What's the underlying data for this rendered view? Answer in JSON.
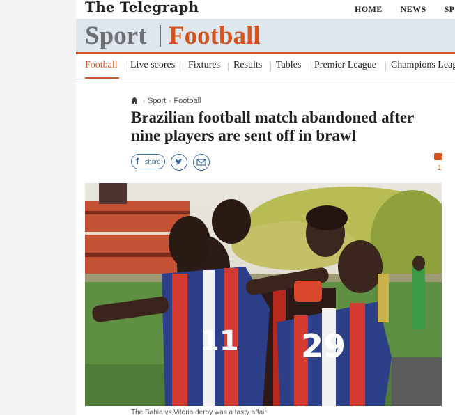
{
  "header": {
    "logo": "The Telegraph",
    "top_nav": [
      "HOME",
      "NEWS",
      "SPO"
    ]
  },
  "section": {
    "sport": "Sport",
    "football": "Football"
  },
  "subnav": [
    {
      "label": "Football",
      "active": true
    },
    {
      "label": "Live scores",
      "active": false
    },
    {
      "label": "Fixtures",
      "active": false
    },
    {
      "label": "Results",
      "active": false
    },
    {
      "label": "Tables",
      "active": false
    },
    {
      "label": "Premier League",
      "active": false
    },
    {
      "label": "Champions Leag",
      "active": false
    }
  ],
  "breadcrumb": {
    "home_icon": "home-icon",
    "items": [
      "Sport",
      "Football"
    ]
  },
  "article": {
    "headline": "Brazilian football match abandoned after nine players are sent off in brawl",
    "share_label": "share",
    "comment_count": "1",
    "caption": "The Bahia vs Vitoria derby was a tasty affair"
  },
  "colors": {
    "accent": "#d1541f",
    "section_band": "#dfe7ee",
    "share_blue": "#3c6ca8"
  }
}
